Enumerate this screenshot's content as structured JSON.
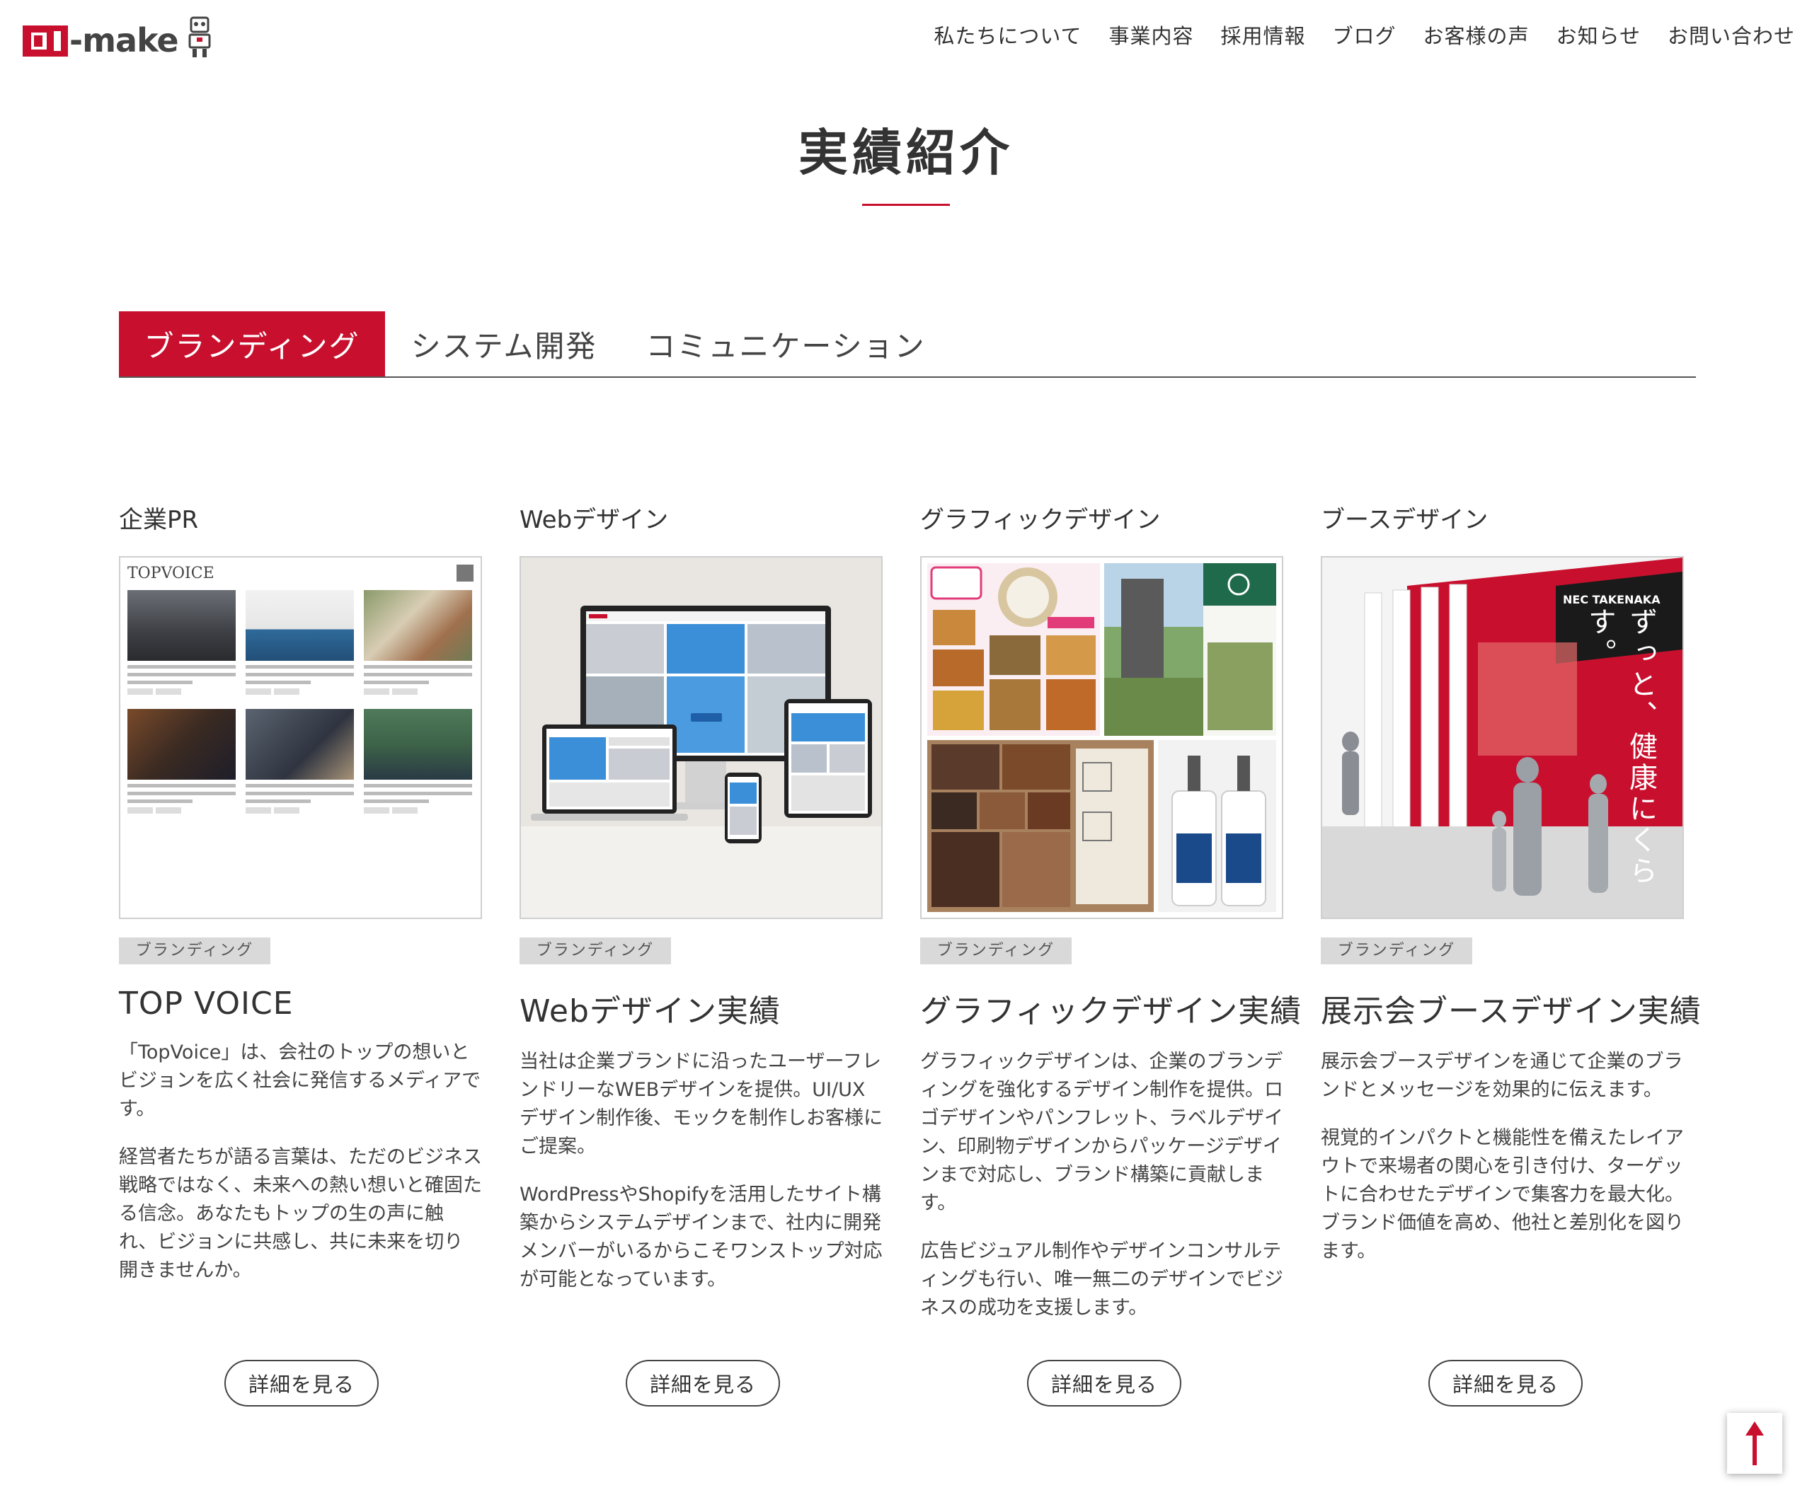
{
  "header": {
    "logo_text": "-make",
    "nav": [
      "私たちについて",
      "事業内容",
      "採用情報",
      "ブログ",
      "お客様の声",
      "お知らせ",
      "お問い合わせ"
    ]
  },
  "page_title": "実績紹介",
  "tabs": [
    {
      "label": "ブランディング",
      "active": true
    },
    {
      "label": "システム開発",
      "active": false
    },
    {
      "label": "コミュニケーション",
      "active": false
    }
  ],
  "cards": [
    {
      "category": "企業PR",
      "tag": "ブランディング",
      "title": "TOP VOICE",
      "paragraphs": [
        "「TopVoice」は、会社のトップの想いとビジョンを広く社会に発信するメディアです。",
        "経営者たちが語る言葉は、ただのビジネス戦略ではなく、未来への熱い想いと確固たる信念。あなたもトップの生の声に触れ、ビジョンに共感し、共に未来を切り開きませんか。"
      ],
      "button": "詳細を見る",
      "thumb_label": "TOPVOICE"
    },
    {
      "category": "Webデザイン",
      "tag": "ブランディング",
      "title": "Webデザイン実績",
      "paragraphs": [
        "当社は企業ブランドに沿ったユーザーフレンドリーなWEBデザインを提供。UI/UXデザイン制作後、モックを制作しお客様にご提案。",
        "WordPressやShopifyを活用したサイト構築からシステムデザインまで、社内に開発メンバーがいるからこそワンストップ対応が可能となっています。"
      ],
      "button": "詳細を見る"
    },
    {
      "category": "グラフィックデザイン",
      "tag": "ブランディング",
      "title": "グラフィックデザイン実績",
      "paragraphs": [
        "グラフィックデザインは、企業のブランディングを強化するデザイン制作を提供。ロゴデザインやパンフレット、ラベルデザイン、印刷物デザインからパッケージデザインまで対応し、ブランド構築に貢献します。",
        "広告ビジュアル制作やデザインコンサルティングも行い、唯一無二のデザインでビジネスの成功を支援します。"
      ],
      "button": "詳細を見る"
    },
    {
      "category": "ブースデザイン",
      "tag": "ブランディング",
      "title": "展示会ブースデザイン実績",
      "paragraphs": [
        "展示会ブースデザインを通じて企業のブランドとメッセージを効果的に伝えます。",
        "視覚的インパクトと機能性を備えたレイアウトで来場者の関心を引き付け、ターゲットに合わせたデザインで集客力を最大化。ブランド価値を高め、他社と差別化を図ります。"
      ],
      "button": "詳細を見る",
      "thumb_text": "ずっと、健康にくらす。",
      "thumb_brand": "NEC  TAKENAKA"
    }
  ],
  "colors": {
    "accent": "#c8102e",
    "tag_bg": "#d9d9d9"
  },
  "icons": {
    "scroll_top": "arrow-up-icon"
  }
}
